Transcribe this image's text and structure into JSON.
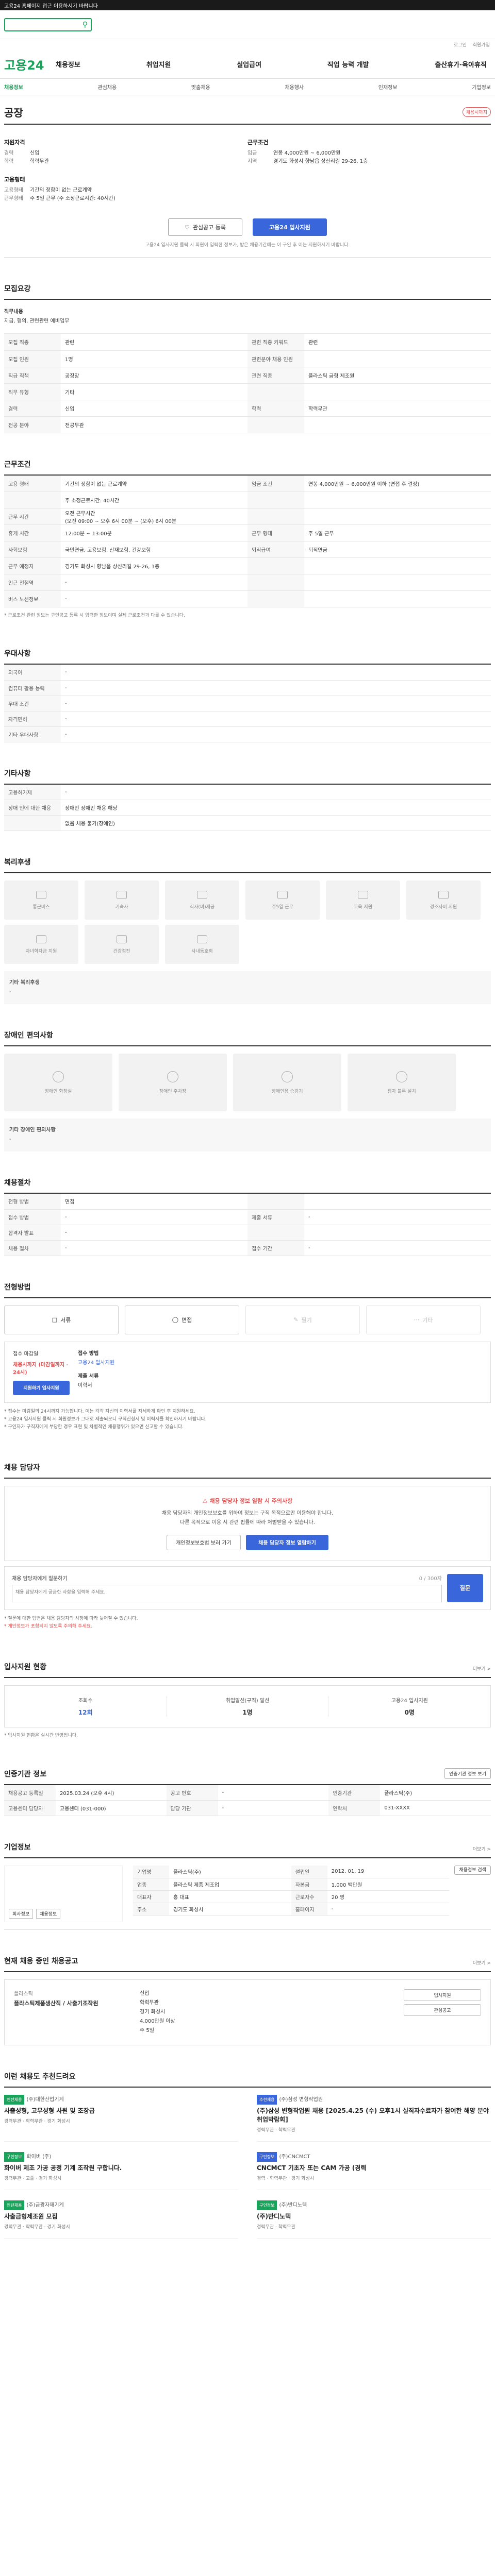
{
  "topbar": {
    "text": "고용24 홈페이지 접근 이용하시기 바랍니다"
  },
  "search": {
    "placeholder": "",
    "icon": "search-icon"
  },
  "util": [
    "로그인",
    "회원가입"
  ],
  "logo": "고용24",
  "gnb": [
    "채용정보",
    "취업지원",
    "실업급여",
    "직업 능력 개발",
    "출산휴가·육아휴직"
  ],
  "lnb": [
    "채용정보",
    "관심채용",
    "맞춤채용",
    "채용행사",
    "인재정보",
    "기업정보"
  ],
  "corp": {
    "name": "공장",
    "badge": "채용시까지"
  },
  "summary": {
    "left_title": "지원자격",
    "left": [
      {
        "k": "경력",
        "v": "신입"
      },
      {
        "k": "학력",
        "v": "학력무관"
      }
    ],
    "left2_title": "고용형태",
    "left2": [
      {
        "k": "고용형태",
        "v": "기간의 정함이 없는 근로계약"
      },
      {
        "k": "근무형태",
        "v": "주 5일 근무 (주 소정근로시간: 40시간)"
      }
    ],
    "right_title": "근무조건",
    "right": [
      {
        "k": "임금",
        "v": "연봉 4,000만원 ~ 6,000만원"
      },
      {
        "k": "지역",
        "v": "경기도 화성시 향남읍 상신리길 29-26, 1층"
      }
    ]
  },
  "buttons": {
    "interest": "관심공고 등록",
    "apply": "고용24 입사지원"
  },
  "notice": "고용24 입사지원 클릭 시 회원이 입력한 정보가, 받은 채용기간에는 이 구인 후 이는 지원하시기 바랍니다.",
  "recruit": {
    "title": "모집요강",
    "duty_label": "직무내용",
    "duty_text": "지급, 협의, 관련관련 예비업무",
    "rows": [
      [
        "모집 직종",
        "관련",
        "관련 직종 키워드",
        "관련"
      ],
      [
        "모집 인원",
        "1명",
        "관련분야 채용 인원",
        ""
      ],
      [
        "직급 직책",
        "공장장",
        "관련 직종",
        "플라스틱 금형 제조원"
      ],
      [
        "직무 유형",
        "기타",
        "",
        ""
      ],
      [
        "경력",
        "신입",
        "학력",
        "학력무관"
      ],
      [
        "전공 분야",
        "전공무관",
        "",
        ""
      ]
    ]
  },
  "condition": {
    "title": "근무조건",
    "rows": [
      [
        "고용 형태",
        "기간의 정함이 없는 근로계약",
        "임금 조건",
        "연봉 4,000만원 ~ 6,000만원 이하 (면접 후 결정)"
      ],
      [
        "",
        "주 소정근로시간: 40시간",
        "",
        ""
      ],
      [
        "근무 시간",
        "오전 근무시간\n(오전 09:00 ~ 오후 6시 00분 ~ (오후) 6시 00분",
        "",
        ""
      ],
      [
        "휴게 시간",
        "12:00분 ~ 13:00분",
        "근무 형태",
        "주 5일 근무"
      ],
      [
        "사회보험",
        "국민연금, 고용보험, 산재보험, 건강보험",
        "퇴직급여",
        "퇴직연금"
      ],
      [
        "근무 예정지",
        "경기도 화성시 향남읍 상신리길 29-26, 1층",
        "",
        ""
      ],
      [
        "인근 전철역",
        "-",
        "",
        ""
      ],
      [
        "버스 노선정보",
        "-",
        "",
        ""
      ]
    ],
    "note": "* 근로조건 관련 정보는 구인공고 등록 시 입력한 정보이며 실제 근로조건과 다를 수 있습니다."
  },
  "pref": {
    "title": "우대사항",
    "rows": [
      [
        "외국어",
        "-"
      ],
      [
        "컴퓨터 활용 능력",
        "-"
      ],
      [
        "우대 조건",
        "-"
      ],
      [
        "자격면허",
        "-"
      ],
      [
        "기타 우대사항",
        "-"
      ]
    ]
  },
  "other": {
    "title": "기타사항",
    "rows": [
      [
        "고용허가제",
        "-"
      ],
      [
        "장애 인에 대한 채용",
        "장애인 장애인 채용 해당"
      ],
      [
        "",
        "없음 채용 불가(장애인)"
      ]
    ]
  },
  "welfare": {
    "title": "복리후생",
    "items": [
      "통근버스",
      "기숙사",
      "식사(비)제공",
      "주5일 근무",
      "교육 지원",
      "경조사비 지원",
      "자녀학자금 지원",
      "건강검진",
      "사내동호회"
    ],
    "extra_title": "기타 복리후생",
    "extra_text": "-"
  },
  "disabled": {
    "title": "장애인 편의사항",
    "items": [
      "장애인 화장실",
      "장애인 주차장",
      "장애인용 승강기",
      "점자 블록 설치"
    ],
    "extra_title": "기타 장애인 편의사항",
    "extra_text": "-"
  },
  "screening": {
    "title": "채용절차",
    "rows": [
      [
        "전형 방법",
        "면접",
        "",
        ""
      ],
      [
        "접수 방법",
        "-",
        "제출 서류",
        "-"
      ],
      [
        "합격자 발표",
        "-",
        "",
        ""
      ],
      [
        "채용 절차",
        "-",
        "접수 기간",
        "-"
      ]
    ]
  },
  "method": {
    "title": "전형방법",
    "items": [
      "서류",
      "면접",
      "필기",
      "기타"
    ]
  },
  "apply": {
    "left_label": "접수 마감일",
    "left_value": "채용시까지 (마감일까지 - 24시)",
    "left_btn": "지원하기 입사지원",
    "right_label": "접수 방법",
    "right_value": "고용24 입사지원",
    "doc_label": "제출 서류",
    "doc_value": "이력서"
  },
  "bullets": [
    "* 접수는 마감일의 24시까지 가능합니다. 이는 각각 자신의 이력서를 자세하게 확인 후 지원하세요.",
    "* 고용24 입사지원 클릭 시 회원정보가 그대로 제출되오니 구직신청서 및 이력서를 확인하시기 바랍니다.",
    "* 구인자가 구직자에게 부당한 경우 표현 및 차별적인 채용행위가 있으면 신고할 수 있습니다."
  ],
  "contact": {
    "title": "채용 담당자",
    "warn_title": "채용 담당자 정보 열람 시 주의사항",
    "warn_text": "채용 담당자의 개인정보보호를 위하여 정보는 구직 목적으로만 이용해야 합니다.\n다른 목적으로 이용 시 관련 법률에 따라 처벌받을 수 있습니다.",
    "btn1": "개인정보보호법 보러 가기",
    "btn2": "채용 담당자 정보 열람하기"
  },
  "question": {
    "label": "채용 담당자에게 질문하기",
    "counter": "0 / 300자",
    "placeholder": "채용 담당자에게 궁금한 사항을 입력해 주세요.",
    "btn": "질문",
    "notes": [
      "* 질문에 대한 답변은 채용 담당자의 사정에 따라 늦어질 수 있습니다.",
      "* 개인정보가 포함되지 않도록 주의해 주세요."
    ]
  },
  "status": {
    "title": "입사지원 현황",
    "more": "더보기 >",
    "items": [
      {
        "label": "조회수",
        "value": "12회"
      },
      {
        "label": "취업알선(구직) 알선",
        "value": "1명"
      },
      {
        "label": "고용24 입사지원",
        "value": "0명"
      }
    ],
    "note": "* 입사지원 현황은 실시간 반영됩니다."
  },
  "reg": {
    "title": "인증기관 정보",
    "btn": "인증기관 정보 보기",
    "rows": [
      [
        "채용공고 등록일",
        "2025.03.24 (오후 4시)",
        "공고 번호",
        "-",
        "인증기관",
        "플라스틱(주)"
      ],
      [
        "고용센터 담당자",
        "고용센터 (031-000)",
        "담당 기관",
        "-",
        "연락처",
        "031-XXXX"
      ]
    ]
  },
  "company": {
    "title": "기업정보",
    "more": "더보기 >",
    "logo_btns": [
      "회사정보",
      "채용정보"
    ],
    "rows": [
      [
        "기업명",
        "플라스틱(주)",
        "설립일",
        "2012. 01. 19"
      ],
      [
        "업종",
        "플라스틱 제품 제조업",
        "자본금",
        "1,000 백만원"
      ],
      [
        "대표자",
        "홍 대표",
        "근로자수",
        "20 명"
      ],
      [
        "주소",
        "경기도 화성시",
        "홈페이지",
        "-"
      ]
    ],
    "side_btn": "채용정보 검색"
  },
  "others": {
    "title": "현재 채용 중인 채용공고",
    "more": "더보기 >",
    "company": "플라스틱",
    "job": "플라스틱제품생산직 / 사출기조작원",
    "meta": [
      "신입",
      "학력무관",
      "경기 화성시",
      "4,000만원 이상",
      "주 5일"
    ],
    "btns": [
      "입사지원",
      "관심공고"
    ]
  },
  "recs": {
    "title": "이런 채용도 추천드려요",
    "items": [
      {
        "tag": "인턴채용",
        "tag_color": "green",
        "co": "(주)대한산업기계",
        "title": "사출성형, 고무성형 사원 및 조장급",
        "meta": "경력무관 · 학력무관 · 경기 화성시"
      },
      {
        "tag": "추천채용",
        "tag_color": "blue",
        "co": "(주)삼성 변형작업원",
        "title": "(주)삼성 변형작업원 채용 [2025.4.25 (수) 오후1시 실직자수료자가 참여한 해양 분야 취업박람회]",
        "meta": "경력무관 · 학력무관"
      },
      {
        "tag": "구인정보",
        "tag_color": "green",
        "co": "화이버 (주)",
        "title": "화이버 제조 가공 공정 기계 조작원 구합니다.",
        "meta": "경력무관 · 고졸 · 경기 화성시"
      },
      {
        "tag": "구인정보",
        "tag_color": "blue",
        "co": "(주)CNCMCT",
        "title": "CNCMCT 기초자 또는 CAM 가공 (경력",
        "meta": "경력 · 학력무관 · 경기 화성시"
      },
      {
        "tag": "인턴채용",
        "tag_color": "green",
        "co": "(주)금광자재기계",
        "title": "사출금형제조원 모집",
        "meta": "경력무관 · 학력무관 · 경기 화성시"
      },
      {
        "tag": "구인정보",
        "tag_color": "green",
        "co": "(주)반디노텍",
        "title": "(주)반디노텍",
        "meta": "경력무관 · 학력무관"
      }
    ]
  }
}
